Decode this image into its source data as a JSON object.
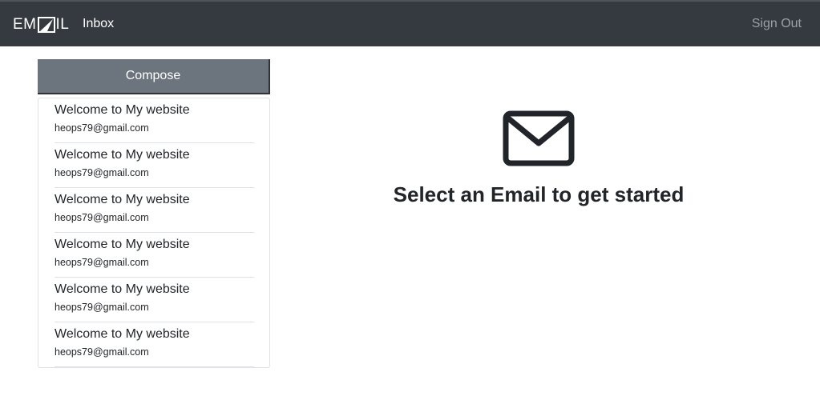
{
  "navbar": {
    "brand_text": "EMAIL",
    "inbox_link": "Inbox",
    "signout_link": "Sign Out"
  },
  "sidebar": {
    "compose_label": "Compose",
    "emails": [
      {
        "subject": "Welcome to My website",
        "sender": "heops79@gmail.com"
      },
      {
        "subject": "Welcome to My website",
        "sender": "heops79@gmail.com"
      },
      {
        "subject": "Welcome to My website",
        "sender": "heops79@gmail.com"
      },
      {
        "subject": "Welcome to My website",
        "sender": "heops79@gmail.com"
      },
      {
        "subject": "Welcome to My website",
        "sender": "heops79@gmail.com"
      },
      {
        "subject": "Welcome to My website",
        "sender": "heops79@gmail.com"
      }
    ]
  },
  "main": {
    "icon": "envelope-icon",
    "message": "Select an Email to get started"
  },
  "colors": {
    "navbar_bg": "#343a40",
    "compose_bg": "#6c757d",
    "text": "#212529"
  }
}
